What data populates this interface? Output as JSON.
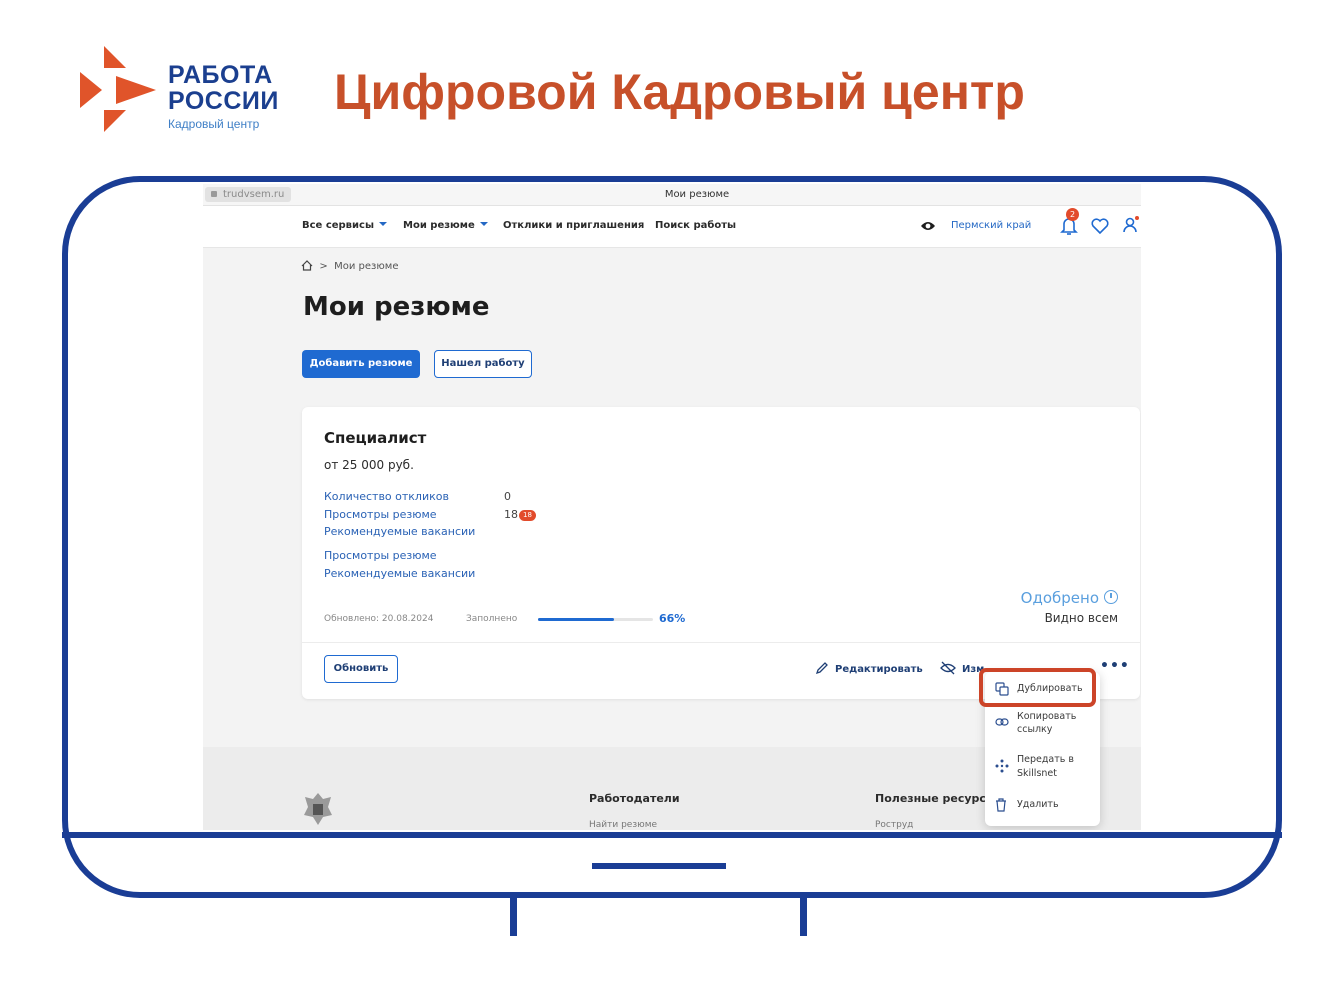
{
  "slide": {
    "logo_line1": "РАБОТА",
    "logo_line2": "РОССИИ",
    "logo_sub": "Кадровый центр",
    "title": "Цифровой Кадровый центр",
    "colors": {
      "title": "#c7502a",
      "frame": "#1a3d95",
      "logo_text": "#1b3f8f",
      "logo_mark": "#e0542a"
    }
  },
  "browser": {
    "url": "trudvsem.ru",
    "tab_title": "Мои резюме"
  },
  "nav": {
    "all_services": "Все сервисы",
    "my_resumes": "Мои резюме",
    "responses": "Отклики и приглашения",
    "job_search": "Поиск работы",
    "region": "Пермский край",
    "notifications_count": "2",
    "icons": [
      "eye-icon",
      "bell-icon",
      "heart-icon",
      "user-icon"
    ]
  },
  "breadcrumb": {
    "separator": ">",
    "current": "Мои резюме"
  },
  "page": {
    "title": "Мои резюме",
    "add_button": "Добавить резюме",
    "found_button": "Нашел работу"
  },
  "resume": {
    "title": "Специалист",
    "salary": "от 25 000 руб.",
    "stats": [
      {
        "label": "Количество откликов",
        "value": "0"
      },
      {
        "label": "Просмотры резюме",
        "value": "18",
        "badge": "18"
      },
      {
        "label": "Рекомендуемые вакансии",
        "value": ""
      },
      {
        "label": "Просмотры резюме",
        "value": ""
      },
      {
        "label": "Рекомендуемые вакансии",
        "value": ""
      }
    ],
    "updated": "Обновлено: 20.08.2024",
    "filled_label": "Заполнено",
    "filled_percent": 66,
    "filled_text": "66%",
    "status": "Одобрено",
    "visibility": "Видно всем",
    "refresh_button": "Обновить",
    "edit_action": "Редактировать",
    "hide_action": "Изм",
    "more_action": "•••"
  },
  "dropdown": {
    "items": [
      {
        "label": "Дублировать",
        "icon": "duplicate-icon"
      },
      {
        "label_line1": "Копировать",
        "label_line2": "ссылку",
        "icon": "link-icon"
      },
      {
        "label_line1": "Передать в",
        "label_line2": "Skillsnet",
        "icon": "transfer-icon"
      },
      {
        "label": "Удалить",
        "icon": "trash-icon"
      }
    ]
  },
  "footer": {
    "employers_title": "Работодатели",
    "employers_link": "Найти резюме",
    "resources_title": "Полезные ресурс",
    "resources_link": "Роструд"
  }
}
